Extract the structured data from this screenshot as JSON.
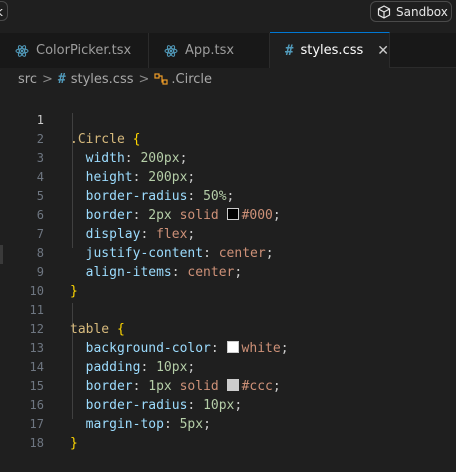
{
  "topbar": {
    "back_label": "k",
    "sandbox_label": "Sandbox"
  },
  "tabs": [
    {
      "label": "ColorPicker.tsx",
      "icon": "react-icon",
      "active": false
    },
    {
      "label": "App.tsx",
      "icon": "react-icon",
      "active": false
    },
    {
      "label": "styles.css",
      "icon": "css-hash-icon",
      "active": true,
      "close": "✕"
    }
  ],
  "breadcrumb": {
    "folder": "src",
    "file": "styles.css",
    "symbol": ".Circle",
    "separator": ">"
  },
  "colors": {
    "react": "#519aba",
    "css": "#519aba",
    "swatch_black": "#000000",
    "swatch_white": "#ffffff",
    "swatch_ccc": "#cccccc"
  },
  "lines": [
    {
      "n": "1",
      "text": ".Circle {"
    },
    {
      "n": "2",
      "text": "width: 200px;"
    },
    {
      "n": "3",
      "text": "height: 200px;"
    },
    {
      "n": "4",
      "text": "border-radius: 50%;"
    },
    {
      "n": "5",
      "text": "border: 2px solid #000;"
    },
    {
      "n": "6",
      "text": "display: flex;"
    },
    {
      "n": "7",
      "text": "justify-content: center;"
    },
    {
      "n": "8",
      "text": "align-items: center;"
    },
    {
      "n": "9",
      "text": "}"
    },
    {
      "n": "10",
      "text": ""
    },
    {
      "n": "11",
      "text": "table {"
    },
    {
      "n": "12",
      "text": "background-color: white;"
    },
    {
      "n": "13",
      "text": "padding: 10px;"
    },
    {
      "n": "14",
      "text": "border: 1px solid #ccc;"
    },
    {
      "n": "15",
      "text": "border-radius: 10px;"
    },
    {
      "n": "16",
      "text": "margin-top: 5px;"
    },
    {
      "n": "17",
      "text": "}"
    },
    {
      "n": "18",
      "text": ""
    }
  ],
  "tokens": {
    "l1_sel": ".Circle",
    "l1_brace": "{",
    "l2_prop": "width",
    "l2_num": "200px",
    "l3_prop": "height",
    "l3_num": "200px",
    "l4_prop": "border-radius",
    "l4_num": "50%",
    "l5_prop": "border",
    "l5_num": "2px",
    "l5_val": "solid",
    "l5_color": "#000",
    "l6_prop": "display",
    "l6_val": "flex",
    "l7_prop": "justify-content",
    "l7_val": "center",
    "l8_prop": "align-items",
    "l8_val": "center",
    "l9_brace": "}",
    "l11_sel": "table",
    "l11_brace": "{",
    "l12_prop": "background-color",
    "l12_val": "white",
    "l13_prop": "padding",
    "l13_num": "10px",
    "l14_prop": "border",
    "l14_num": "1px",
    "l14_val": "solid",
    "l14_color": "#ccc",
    "l15_prop": "border-radius",
    "l15_num": "10px",
    "l16_prop": "margin-top",
    "l16_num": "5px",
    "l17_brace": "}"
  }
}
